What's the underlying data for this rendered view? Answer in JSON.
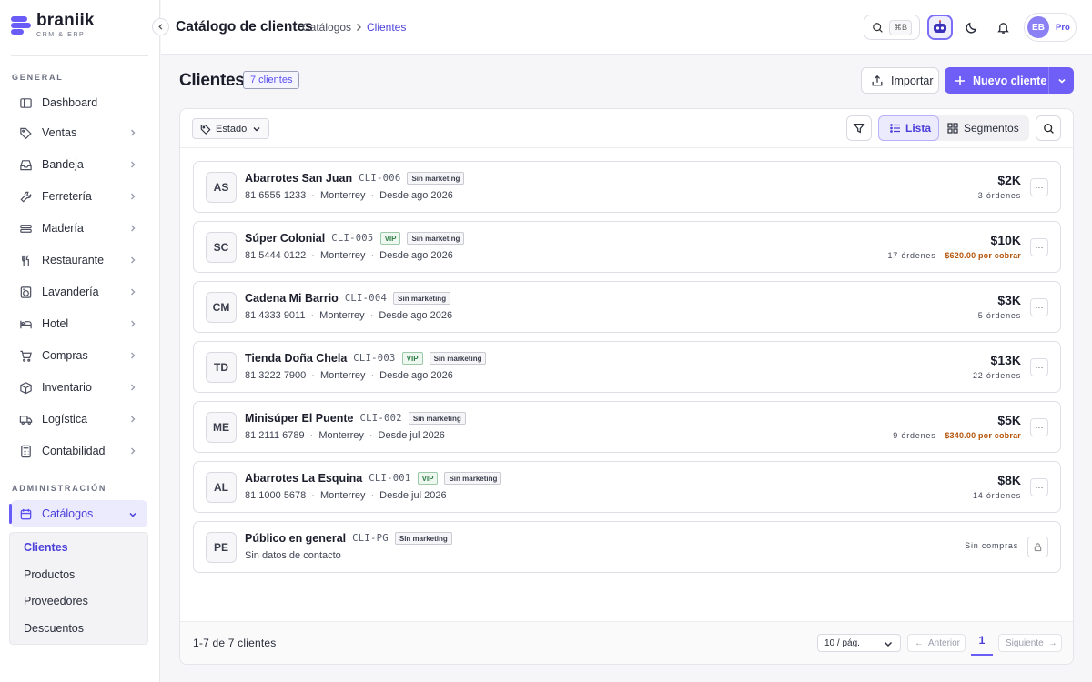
{
  "brand": {
    "name": "braniik",
    "tagline": "CRM & ERP"
  },
  "sidebar": {
    "section_general": "GENERAL",
    "section_admin": "ADMINISTRACIÓN",
    "items": [
      {
        "label": "Dashboard",
        "icon": "dashboard-icon"
      },
      {
        "label": "Ventas",
        "icon": "tag-icon"
      },
      {
        "label": "Bandeja",
        "icon": "inbox-icon"
      },
      {
        "label": "Ferretería",
        "icon": "wrench-icon"
      },
      {
        "label": "Madería",
        "icon": "wood-icon"
      },
      {
        "label": "Restaurante",
        "icon": "utensils-icon"
      },
      {
        "label": "Lavandería",
        "icon": "washer-icon"
      },
      {
        "label": "Hotel",
        "icon": "bed-icon"
      },
      {
        "label": "Compras",
        "icon": "cart-icon"
      },
      {
        "label": "Inventario",
        "icon": "box-icon"
      },
      {
        "label": "Logística",
        "icon": "truck-icon"
      },
      {
        "label": "Contabilidad",
        "icon": "calculator-icon"
      }
    ],
    "catalogos": {
      "label": "Catálogos",
      "icon": "catalog-icon"
    },
    "submenu": [
      "Clientes",
      "Productos",
      "Proveedores",
      "Descuentos"
    ]
  },
  "topbar": {
    "title": "Catálogo de clientes",
    "breadcrumb": [
      "Catálogos",
      "Clientes"
    ],
    "search_shortcut": "⌘B",
    "avatar_initials": "EB",
    "plan": "Pro"
  },
  "page": {
    "title": "Clientes",
    "count_badge": "7 clientes",
    "import_label": "Importar",
    "new_label": "Nuevo cliente"
  },
  "filters": {
    "estado_label": "Estado",
    "view_lista": "Lista",
    "view_segmentos": "Segmentos"
  },
  "customers": [
    {
      "initials": "AS",
      "name": "Abarrotes San Juan",
      "code": "CLI-006",
      "vip": false,
      "marketing": "Sin marketing",
      "phone": "81 6555 1233",
      "city": "Monterrey",
      "since": "Desde ago 2026",
      "amount": "$2K",
      "orders": "3 órdenes",
      "due": ""
    },
    {
      "initials": "SC",
      "name": "Súper Colonial",
      "code": "CLI-005",
      "vip": true,
      "marketing": "Sin marketing",
      "phone": "81 5444 0122",
      "city": "Monterrey",
      "since": "Desde ago 2026",
      "amount": "$10K",
      "orders": "17 órdenes",
      "due": "$620.00 por cobrar"
    },
    {
      "initials": "CM",
      "name": "Cadena Mi Barrio",
      "code": "CLI-004",
      "vip": false,
      "marketing": "Sin marketing",
      "phone": "81 4333 9011",
      "city": "Monterrey",
      "since": "Desde ago 2026",
      "amount": "$3K",
      "orders": "5 órdenes",
      "due": ""
    },
    {
      "initials": "TD",
      "name": "Tienda Doña Chela",
      "code": "CLI-003",
      "vip": true,
      "marketing": "Sin marketing",
      "phone": "81 3222 7900",
      "city": "Monterrey",
      "since": "Desde ago 2026",
      "amount": "$13K",
      "orders": "22 órdenes",
      "due": ""
    },
    {
      "initials": "ME",
      "name": "Minisúper El Puente",
      "code": "CLI-002",
      "vip": false,
      "marketing": "Sin marketing",
      "phone": "81 2111 6789",
      "city": "Monterrey",
      "since": "Desde jul 2026",
      "amount": "$5K",
      "orders": "9 órdenes",
      "due": "$340.00 por cobrar"
    },
    {
      "initials": "AL",
      "name": "Abarrotes La Esquina",
      "code": "CLI-001",
      "vip": true,
      "marketing": "Sin marketing",
      "phone": "81 1000 5678",
      "city": "Monterrey",
      "since": "Desde jul 2026",
      "amount": "$8K",
      "orders": "14 órdenes",
      "due": ""
    }
  ],
  "public_customer": {
    "initials": "PE",
    "name": "Público en general",
    "code": "CLI-PG",
    "marketing": "Sin marketing",
    "contact": "Sin datos de contacto",
    "status": "Sin compras"
  },
  "vip_label": "VIP",
  "pagination": {
    "range": "1-7 de 7 clientes",
    "per_page": "10 / pág.",
    "prev": "Anterior",
    "next": "Siguiente",
    "current": "1"
  }
}
